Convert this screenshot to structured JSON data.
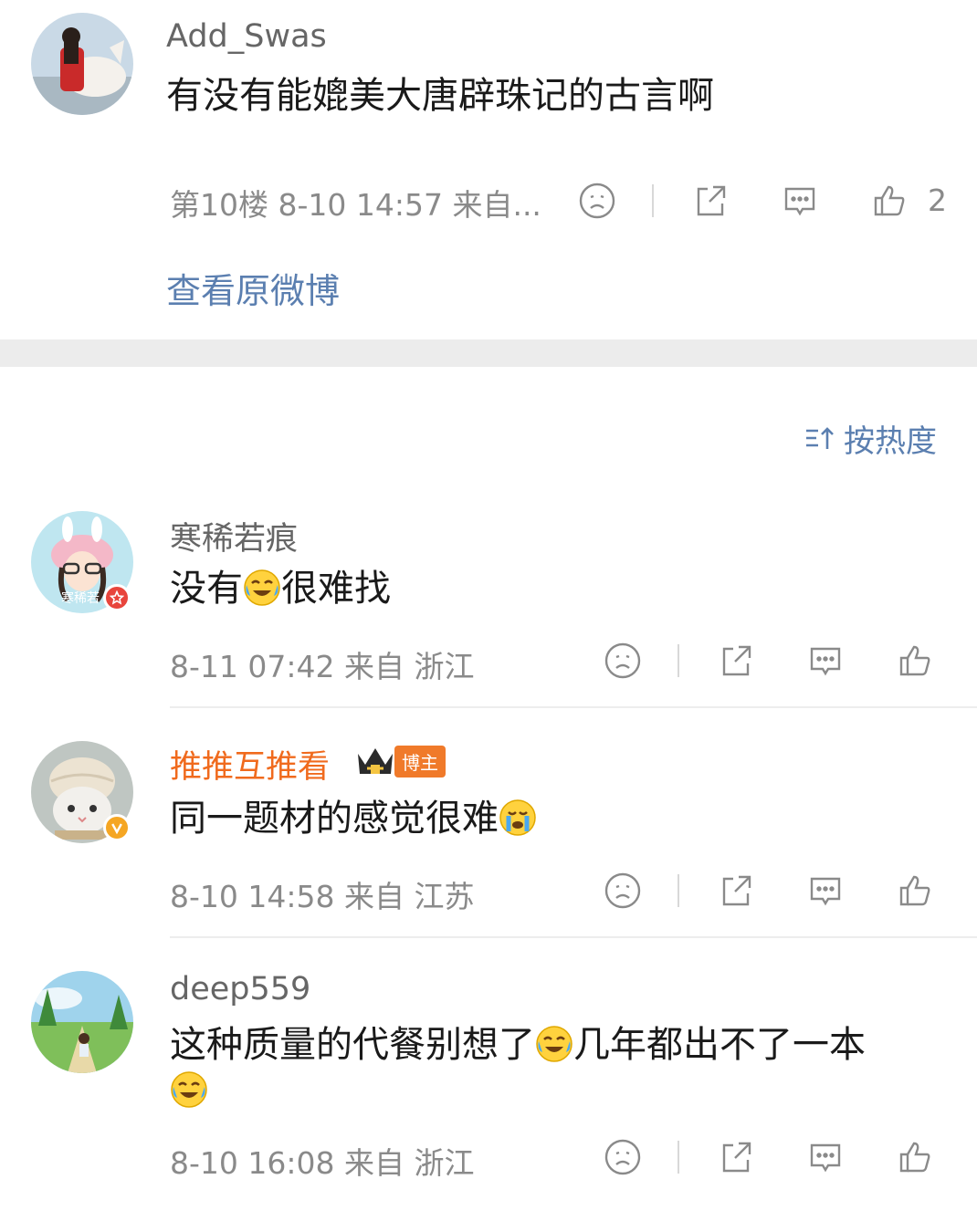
{
  "top_comment": {
    "username": "Add_Swas",
    "text": "有没有能媲美大唐辟珠记的古言啊",
    "meta": "第10楼 8-10 14:57 来自...",
    "like_count": "2",
    "view_original": "查看原微博"
  },
  "sort": {
    "label": "按热度",
    "icon": "sort-icon"
  },
  "comments": [
    {
      "username": "寒稀若痕",
      "text_before": "没有",
      "emoji": "crying-laughing-emoji",
      "text_after": "很难找",
      "meta": "8-11 07:42 来自 浙江",
      "avatar_label": "寒稀若"
    },
    {
      "username": "推推互推看",
      "tag": "博主",
      "text_before": "同一题材的感觉很难",
      "emoji": "crying-emoji",
      "text_after": "",
      "meta": "8-10 14:58 来自 江苏"
    },
    {
      "username": "deep559",
      "text_before": "这种质量的代餐别想了",
      "emoji": "crying-laughing-emoji",
      "text_after": "几年都出不了一本",
      "meta": "8-10 16:08 来自 浙江"
    }
  ],
  "colors": {
    "link": "#5b7fb0",
    "orange_name": "#f06a1d",
    "section_gap": "#ececec"
  }
}
